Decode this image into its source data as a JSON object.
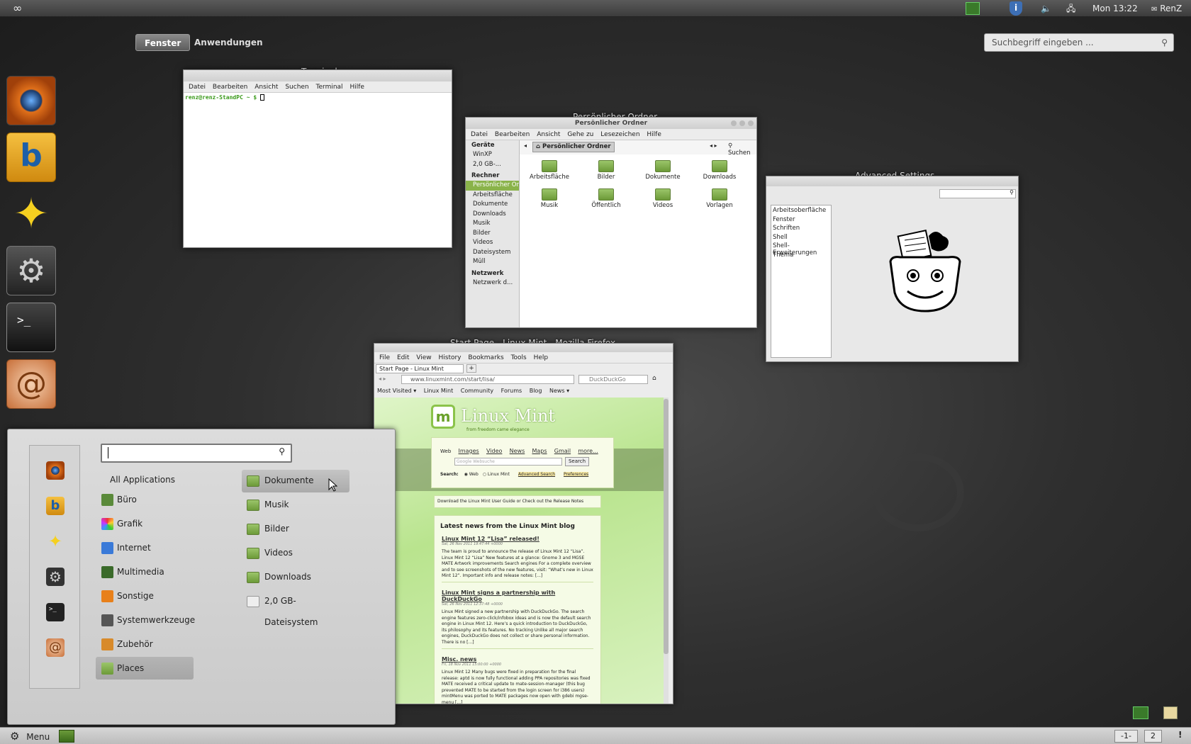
{
  "top_panel": {
    "clock": "Mon 13:22",
    "user": "RenZ",
    "icons": [
      "infinity-icon",
      "cpu-monitor-icon",
      "shield-icon",
      "volume-icon",
      "network-icon"
    ]
  },
  "overview": {
    "tab_windows": "Fenster",
    "tab_applications": "Anwendungen",
    "search_placeholder": "Suchbegriff eingeben ..."
  },
  "terminal": {
    "title": "Terminal",
    "menu": [
      "Datei",
      "Bearbeiten",
      "Ansicht",
      "Suchen",
      "Terminal",
      "Hilfe"
    ],
    "prompt": "renz@renz-StandPC ~ $"
  },
  "file_manager": {
    "overlay_title": "Persönlicher Ordner",
    "title": "Persönlicher Ordner",
    "menu": [
      "Datei",
      "Bearbeiten",
      "Ansicht",
      "Gehe zu",
      "Lesezeichen",
      "Hilfe"
    ],
    "location": "Persönlicher Ordner",
    "search_label": "Suchen",
    "devices_heading": "Geräte",
    "devices": [
      "WinXP",
      "2,0 GB-..."
    ],
    "computer_heading": "Rechner",
    "computer": [
      "Persönlicher Ordner",
      "Arbeitsfläche",
      "Dokumente",
      "Downloads",
      "Musik",
      "Bilder",
      "Videos",
      "Dateisystem",
      "Müll"
    ],
    "network_heading": "Netzwerk",
    "network": [
      "Netzwerk d..."
    ],
    "folders": [
      "Arbeitsfläche",
      "Bilder",
      "Dokumente",
      "Downloads",
      "Musik",
      "Öffentlich",
      "Videos",
      "Vorlagen"
    ]
  },
  "advanced_settings": {
    "title": "Advanced Settings",
    "items": [
      "Arbeitsoberfläche",
      "Fenster",
      "Schriften",
      "Shell",
      "Shell-Erweiterungen",
      "Thema"
    ]
  },
  "firefox": {
    "title": "Start Page - Linux Mint - Mozilla Firefox",
    "menu": [
      "File",
      "Edit",
      "View",
      "History",
      "Bookmarks",
      "Tools",
      "Help"
    ],
    "tab": "Start Page - Linux Mint",
    "url": "www.linuxmint.com/start/lisa/",
    "search_engine": "DuckDuckGo",
    "bookmarks": [
      "Most Visited ▾",
      "Linux Mint",
      "Community",
      "Forums",
      "Blog",
      "News ▾"
    ],
    "page": {
      "logo": "Linux Mint",
      "tagline": "from freedom came elegance",
      "search_tabs": [
        "Web",
        "Images",
        "Video",
        "News",
        "Maps",
        "Gmail",
        "more..."
      ],
      "search_placeholder": "Google Websuche",
      "search_button": "Search",
      "search_label": "Search:",
      "radio_web": "Web",
      "radio_mint": "Linux Mint",
      "advanced": "Advanced Search",
      "preferences": "Preferences",
      "guide": "Download the Linux Mint User Guide or Check out the Release Notes",
      "news_heading": "Latest news from the Linux Mint blog",
      "news": [
        {
          "title": "Linux Mint 12 “Lisa” released!",
          "date": "Sat, 26 Nov 2011 19:47:44 +0000",
          "body": "The team is proud to announce the release of Linux Mint 12 “Lisa”. Linux Mint 12 “Lisa” New features at a glance: Gnome 3 and MGSE MATE Artwork improvements Search engines For a complete overview and to see screenshots of the new features, visit: “What’s new in Linux Mint 12”. Important info and release notes: [...]"
        },
        {
          "title": "Linux Mint signs a partnership with DuckDuckGo",
          "date": "Sat, 26 Nov 2011 12:37:48 +0000",
          "body": "Linux Mint signed a new partnership with DuckDuckGo. The search engine features zero-click/infobox ideas and is now the default search engine in Linux Mint 12. Here’s a quick introduction to DuckDuckGo, its philosophy and its features. No tracking Unlike all major search engines, DuckDuckGo does not collect or share personal information. There is no [...]"
        },
        {
          "title": "Misc. news",
          "date": "Fri, 18 Nov 2011 15:00:00 +0000",
          "body": "Linux Mint 12 Many bugs were fixed in preparation for the final release: aptd is now fully functional adding PPA repositories was fixed MATE received a critical update to mate-session-manager (this bug prevented MATE to be started from the login screen for i386 users) mintMenu was ported to MATE packages now open with gdebi mgse-menu [...]"
        }
      ]
    }
  },
  "menu": {
    "search_value": "",
    "all_applications": "All Applications",
    "categories": [
      "Büro",
      "Grafik",
      "Internet",
      "Multimedia",
      "Sonstige",
      "Systemwerkzeuge",
      "Zubehör",
      "Places"
    ],
    "selected_category": "Places",
    "places": [
      "Dokumente",
      "Musik",
      "Bilder",
      "Videos",
      "Downloads",
      "2,0 GB-Dateisystem"
    ],
    "selected_place": "Dokumente"
  },
  "bottom_panel": {
    "menu_label": "Menu",
    "workspace_1": "-1-",
    "workspace_2": "2",
    "alert": "!"
  },
  "colors": {
    "mint_green": "#8bc34a",
    "folder_green": "#7aa94a",
    "panel_dark": "#3c3c3c"
  }
}
